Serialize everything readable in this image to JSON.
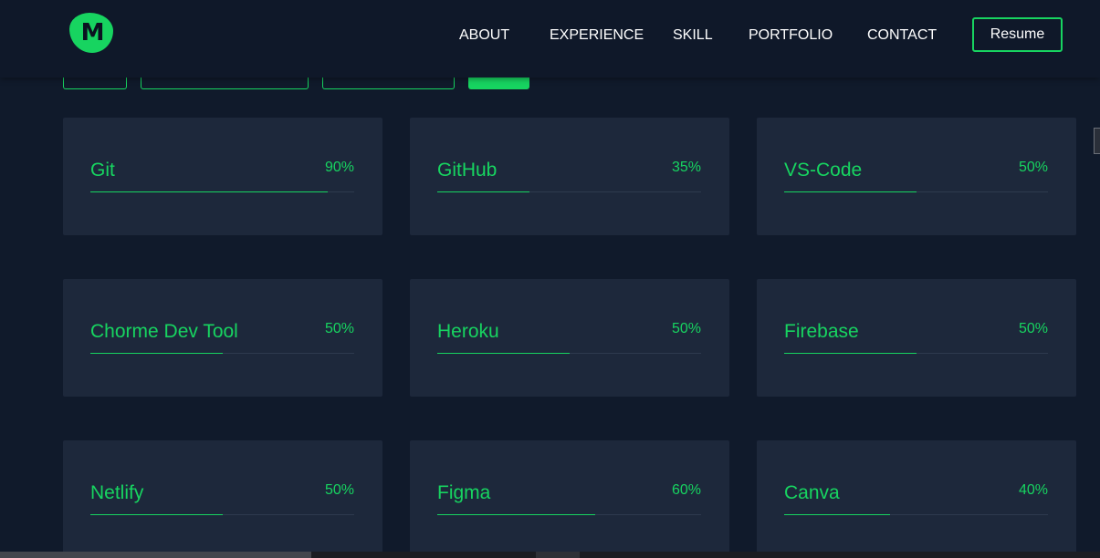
{
  "logo": {
    "letter": "M"
  },
  "nav": {
    "links": [
      "ABOUT",
      "EXPERIENCE",
      "SKILL",
      "PORTFOLIO",
      "CONTACT"
    ],
    "resume_label": "Resume"
  },
  "colors": {
    "accent": "#17d460",
    "background": "#101a2b",
    "card": "#1d283b",
    "navbar": "#0f1829"
  },
  "skills": [
    {
      "name": "Git",
      "percent_label": "90%",
      "level": 0.9
    },
    {
      "name": "GitHub",
      "percent_label": "35%",
      "level": 0.35
    },
    {
      "name": "VS-Code",
      "percent_label": "50%",
      "level": 0.5
    },
    {
      "name": "Chorme Dev Tool",
      "percent_label": "50%",
      "level": 0.5
    },
    {
      "name": "Heroku",
      "percent_label": "50%",
      "level": 0.5
    },
    {
      "name": "Firebase",
      "percent_label": "50%",
      "level": 0.5
    },
    {
      "name": "Netlify",
      "percent_label": "50%",
      "level": 0.5
    },
    {
      "name": "Figma",
      "percent_label": "60%",
      "level": 0.6
    },
    {
      "name": "Canva",
      "percent_label": "40%",
      "level": 0.4
    }
  ]
}
